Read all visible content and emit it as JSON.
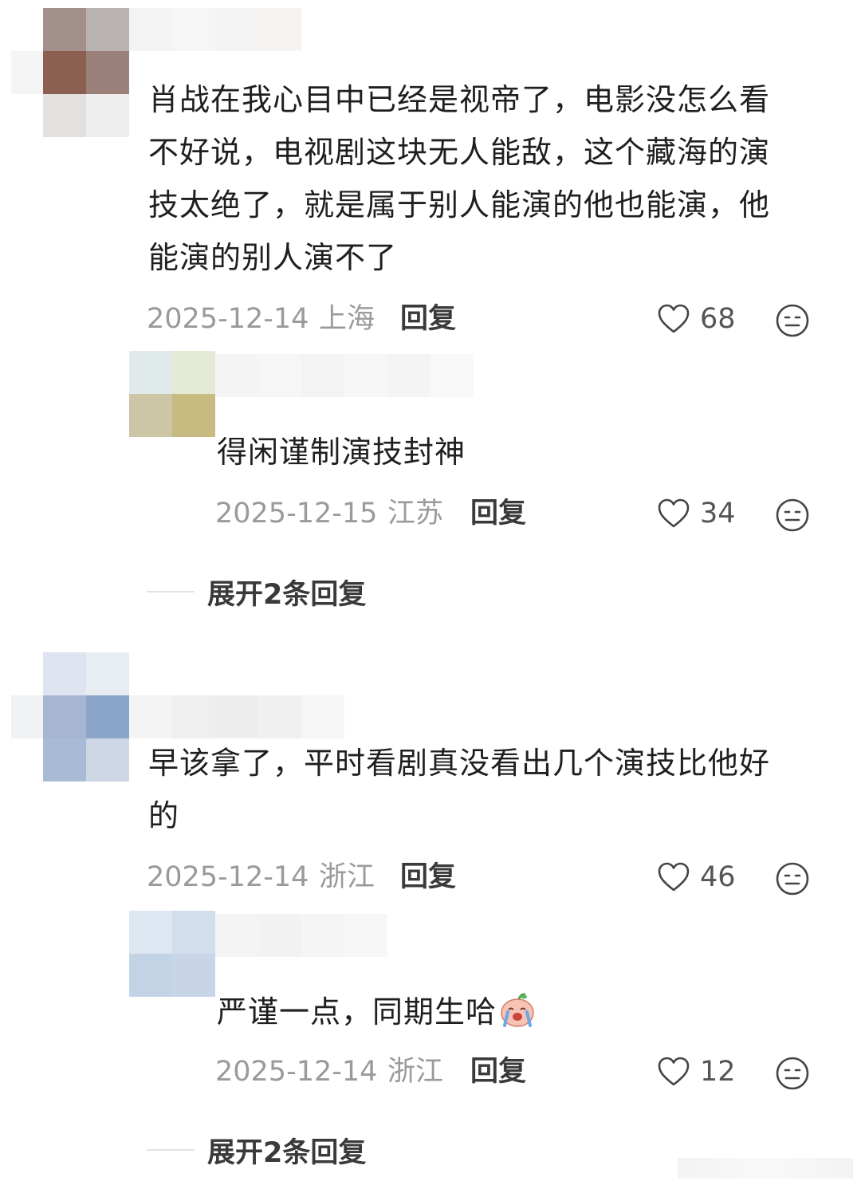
{
  "colors": {
    "text": "#1f1f1f",
    "meta": "#9a9a9a",
    "action": "#3a3a3a",
    "background": "#ffffff"
  },
  "comments": [
    {
      "text": "肖战在我心目中已经是视帝了，电影没怎么看不好说，电视剧这块无人能敌，这个藏海的演技太绝了，就是属于别人能演的他也能演，他能演的别人演不了",
      "lines": [
        "肖战在我心目中已经是视帝了，电影没怎么看",
        "不好说，电视剧这块无人能敌，这个藏海的演",
        "技太绝了，就是属于别人能演的他也能演，他",
        "能演的别人演不了"
      ],
      "date": "2025-12-14",
      "location": "上海",
      "reply_label": "回复",
      "likes": "68",
      "reply": {
        "text": "得闲谨制演技封神",
        "date": "2025-12-15",
        "location": "江苏",
        "reply_label": "回复",
        "likes": "34"
      },
      "expand_label": "展开2条回复"
    },
    {
      "text": "早该拿了，平时看剧真没看出几个演技比他好的",
      "lines": [
        "早该拿了，平时看剧真没看出几个演技比他好",
        "的"
      ],
      "date": "2025-12-14",
      "location": "浙江",
      "reply_label": "回复",
      "likes": "46",
      "reply": {
        "text": "严谨一点，同期生哈",
        "emoji": "crying-laughing-emoji",
        "date": "2025-12-14",
        "location": "浙江",
        "reply_label": "回复",
        "likes": "12"
      },
      "expand_label": "展开2条回复"
    }
  ],
  "icons": {
    "like": "heart-outline-icon",
    "more": "neutral-face-icon"
  }
}
